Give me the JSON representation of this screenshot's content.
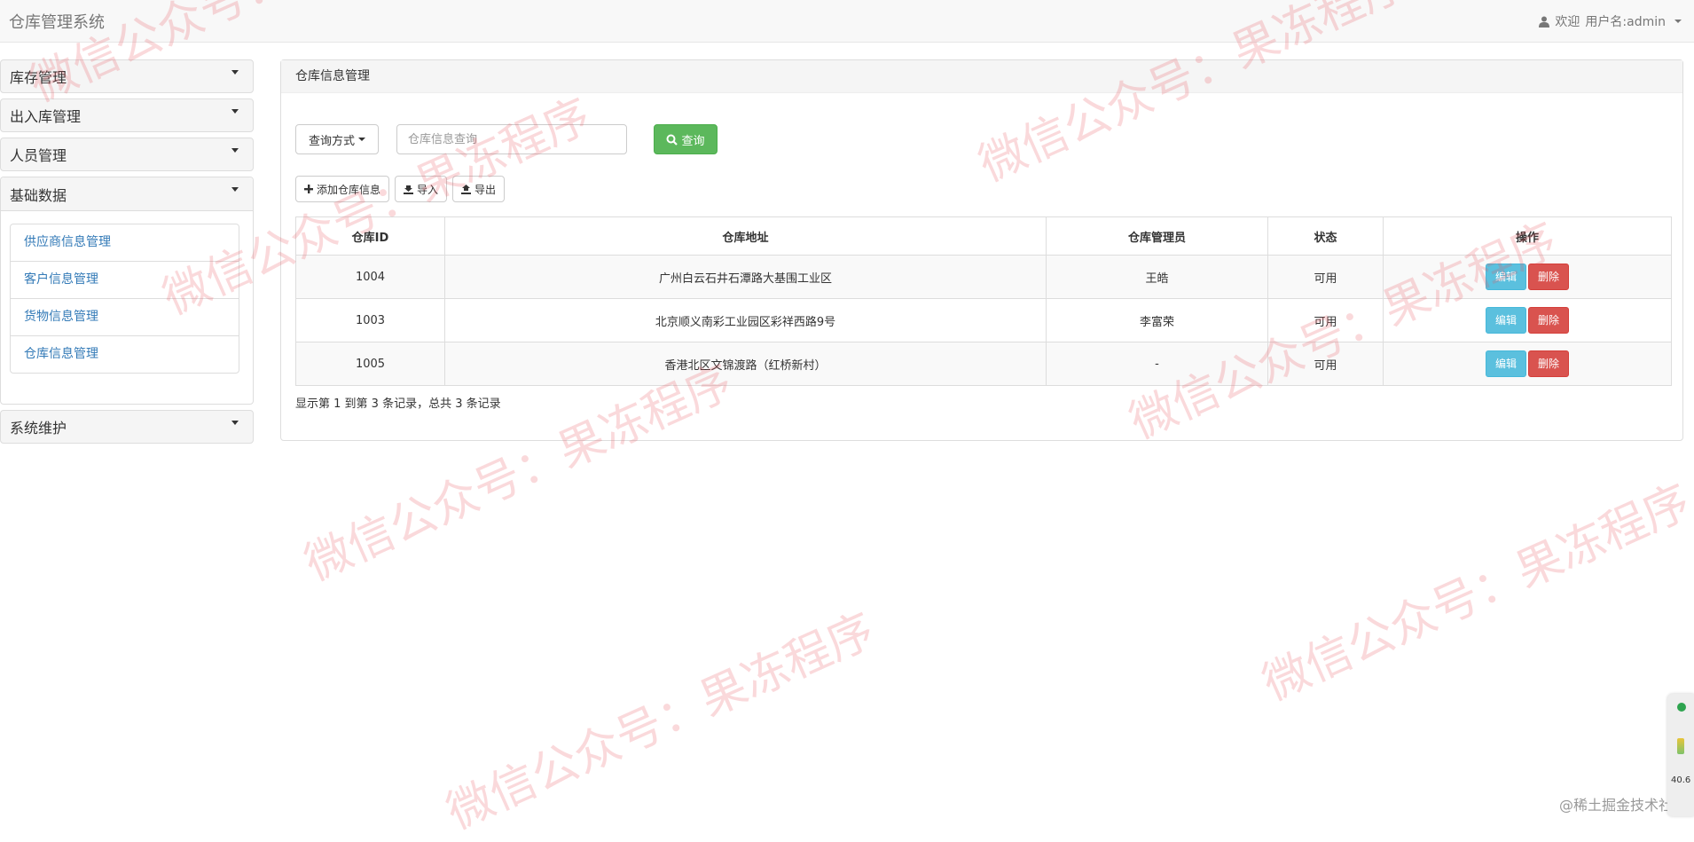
{
  "app": {
    "title": "仓库管理系统"
  },
  "user_menu": {
    "welcome": "欢迎",
    "username_label": "用户名:admin"
  },
  "sidebar": {
    "sections": [
      {
        "label": "库存管理"
      },
      {
        "label": "出入库管理"
      },
      {
        "label": "人员管理"
      },
      {
        "label": "基础数据",
        "items": [
          "供应商信息管理",
          "客户信息管理",
          "货物信息管理",
          "仓库信息管理"
        ]
      },
      {
        "label": "系统维护"
      }
    ]
  },
  "main": {
    "panel_title": "仓库信息管理",
    "query_dropdown_label": "查询方式",
    "search_placeholder": "仓库信息查询",
    "search_button_label": "查询",
    "toolbar": {
      "add_label": "添加仓库信息",
      "import_label": "导入",
      "export_label": "导出"
    },
    "table": {
      "columns": [
        "仓库ID",
        "仓库地址",
        "仓库管理员",
        "状态",
        "操作"
      ],
      "rows": [
        {
          "id": "1004",
          "address": "广州白云石井石潭路大基围工业区",
          "manager": "王皓",
          "status": "可用"
        },
        {
          "id": "1003",
          "address": "北京顺义南彩工业园区彩祥西路9号",
          "manager": "李富荣",
          "status": "可用"
        },
        {
          "id": "1005",
          "address": "香港北区文锦渡路（红桥新村）",
          "manager": "-",
          "status": "可用"
        }
      ],
      "edit_label": "编辑",
      "delete_label": "删除"
    },
    "pagination_info": "显示第 1 到第 3 条记录，总共 3 条记录"
  },
  "watermark": {
    "text": "微信公众号：果冻程序",
    "corner_text": "@稀土掘金技术社区"
  },
  "float_widget": {
    "value": "40.6"
  },
  "colors": {
    "primary_link": "#337ab7",
    "success": "#5cb85c",
    "info": "#5bc0de",
    "danger": "#d9534f"
  }
}
